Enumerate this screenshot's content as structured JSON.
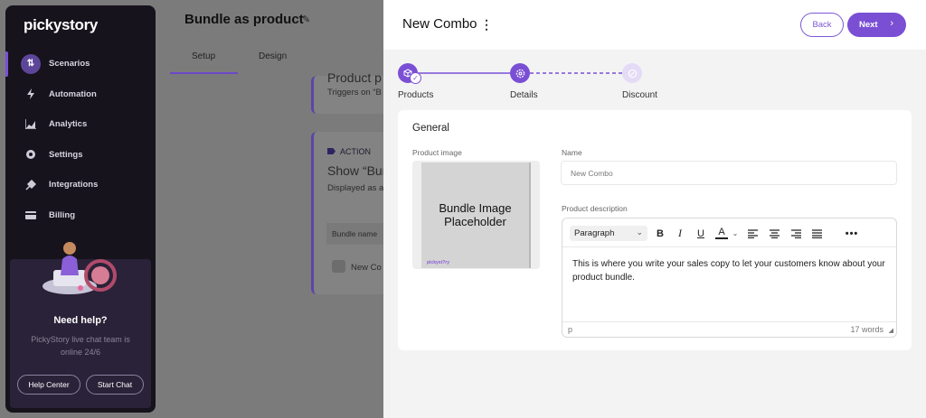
{
  "sidebar": {
    "logo": "pickystory",
    "items": [
      {
        "label": "Scenarios",
        "icon": "scenarios-icon"
      },
      {
        "label": "Automation",
        "icon": "lightning-icon"
      },
      {
        "label": "Analytics",
        "icon": "chart-icon"
      },
      {
        "label": "Settings",
        "icon": "gear-icon"
      },
      {
        "label": "Integrations",
        "icon": "plug-icon"
      },
      {
        "label": "Billing",
        "icon": "card-icon"
      }
    ],
    "help": {
      "title": "Need help?",
      "subtitle": "PickyStory live chat team is online 24/6",
      "help_center": "Help Center",
      "start_chat": "Start Chat"
    }
  },
  "background": {
    "title": "Bundle as product",
    "tabs": [
      "Setup",
      "Design"
    ],
    "card1": {
      "title": "Product p",
      "sub": "Triggers on “B"
    },
    "card2": {
      "tag": "ACTION",
      "title": "Show “Bun",
      "sub": "Displayed as a",
      "col_header": "Bundle name",
      "row": "New Co"
    }
  },
  "panel": {
    "title": "New Combo",
    "back_label": "Back",
    "next_label": "Next",
    "steps": [
      {
        "label": "Products",
        "state": "done"
      },
      {
        "label": "Details",
        "state": "current"
      },
      {
        "label": "Discount",
        "state": "pending"
      }
    ],
    "general": {
      "title": "General",
      "product_image_label": "Product image",
      "image_placeholder_line1": "Bundle Image",
      "image_placeholder_line2": "Placeholder",
      "image_brand": "pickyst?ry",
      "name_label": "Name",
      "name_value": "New Combo",
      "description_label": "Product description",
      "format_select": "Paragraph",
      "description_text": "This is where you write your sales copy to let your customers know about your product bundle.",
      "status_path": "p",
      "word_count": "17 words"
    }
  },
  "colors": {
    "accent": "#7a4fd4",
    "sidebar_bg": "#16131c",
    "overlay_bg": "#7b7b7b",
    "panel_bg": "#f3f3f4"
  }
}
